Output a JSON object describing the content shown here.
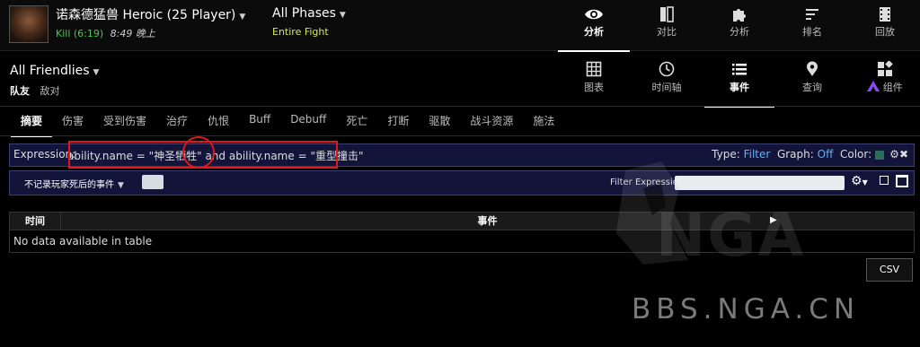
{
  "header": {
    "boss": "诺森德猛兽 Heroic (25 Player)",
    "kill": "Kill (6:19)",
    "time": "8:49 晚上",
    "phases": "All Phases",
    "fight": "Entire Fight",
    "nav": [
      {
        "label": "分析",
        "icon": "eye-icon"
      },
      {
        "label": "对比",
        "icon": "compare-icon"
      },
      {
        "label": "分析",
        "icon": "puzzle-icon"
      },
      {
        "label": "排名",
        "icon": "ranking-icon"
      },
      {
        "label": "回放",
        "icon": "film-icon"
      }
    ]
  },
  "subheader": {
    "friendlies": "All Friendlies",
    "tab_friendly": "队友",
    "tab_enemy": "敌对",
    "views": [
      {
        "label": "图表",
        "icon": "grid-icon"
      },
      {
        "label": "时间轴",
        "icon": "clock-icon"
      },
      {
        "label": "事件",
        "icon": "list-icon"
      },
      {
        "label": "查询",
        "icon": "map-pin-icon"
      },
      {
        "label": "组件",
        "icon": "widgets-icon"
      }
    ]
  },
  "tabs": [
    "摘要",
    "伤害",
    "受到伤害",
    "治疗",
    "仇恨",
    "Buff",
    "Debuff",
    "死亡",
    "打断",
    "驱散",
    "战斗资源",
    "施法"
  ],
  "expression": {
    "label": "Expression:",
    "text": "ability.name = \"神圣牺牲\" and ability.name = \"重型撞击\"",
    "type_label": "Type:",
    "type_value": "Filter",
    "graph_label": "Graph:",
    "graph_value": "Off",
    "color_label": "Color:",
    "color": "#2c6e5a"
  },
  "filter": {
    "dropdown": "不记录玩家死后的事件",
    "label": "Filter Expression:",
    "value": ""
  },
  "table": {
    "col_time": "时间",
    "col_event": "事件",
    "empty": "No data available in table"
  },
  "csv": "CSV",
  "watermark": {
    "logo": "NGA",
    "site": "BBS.NGA.CN"
  }
}
